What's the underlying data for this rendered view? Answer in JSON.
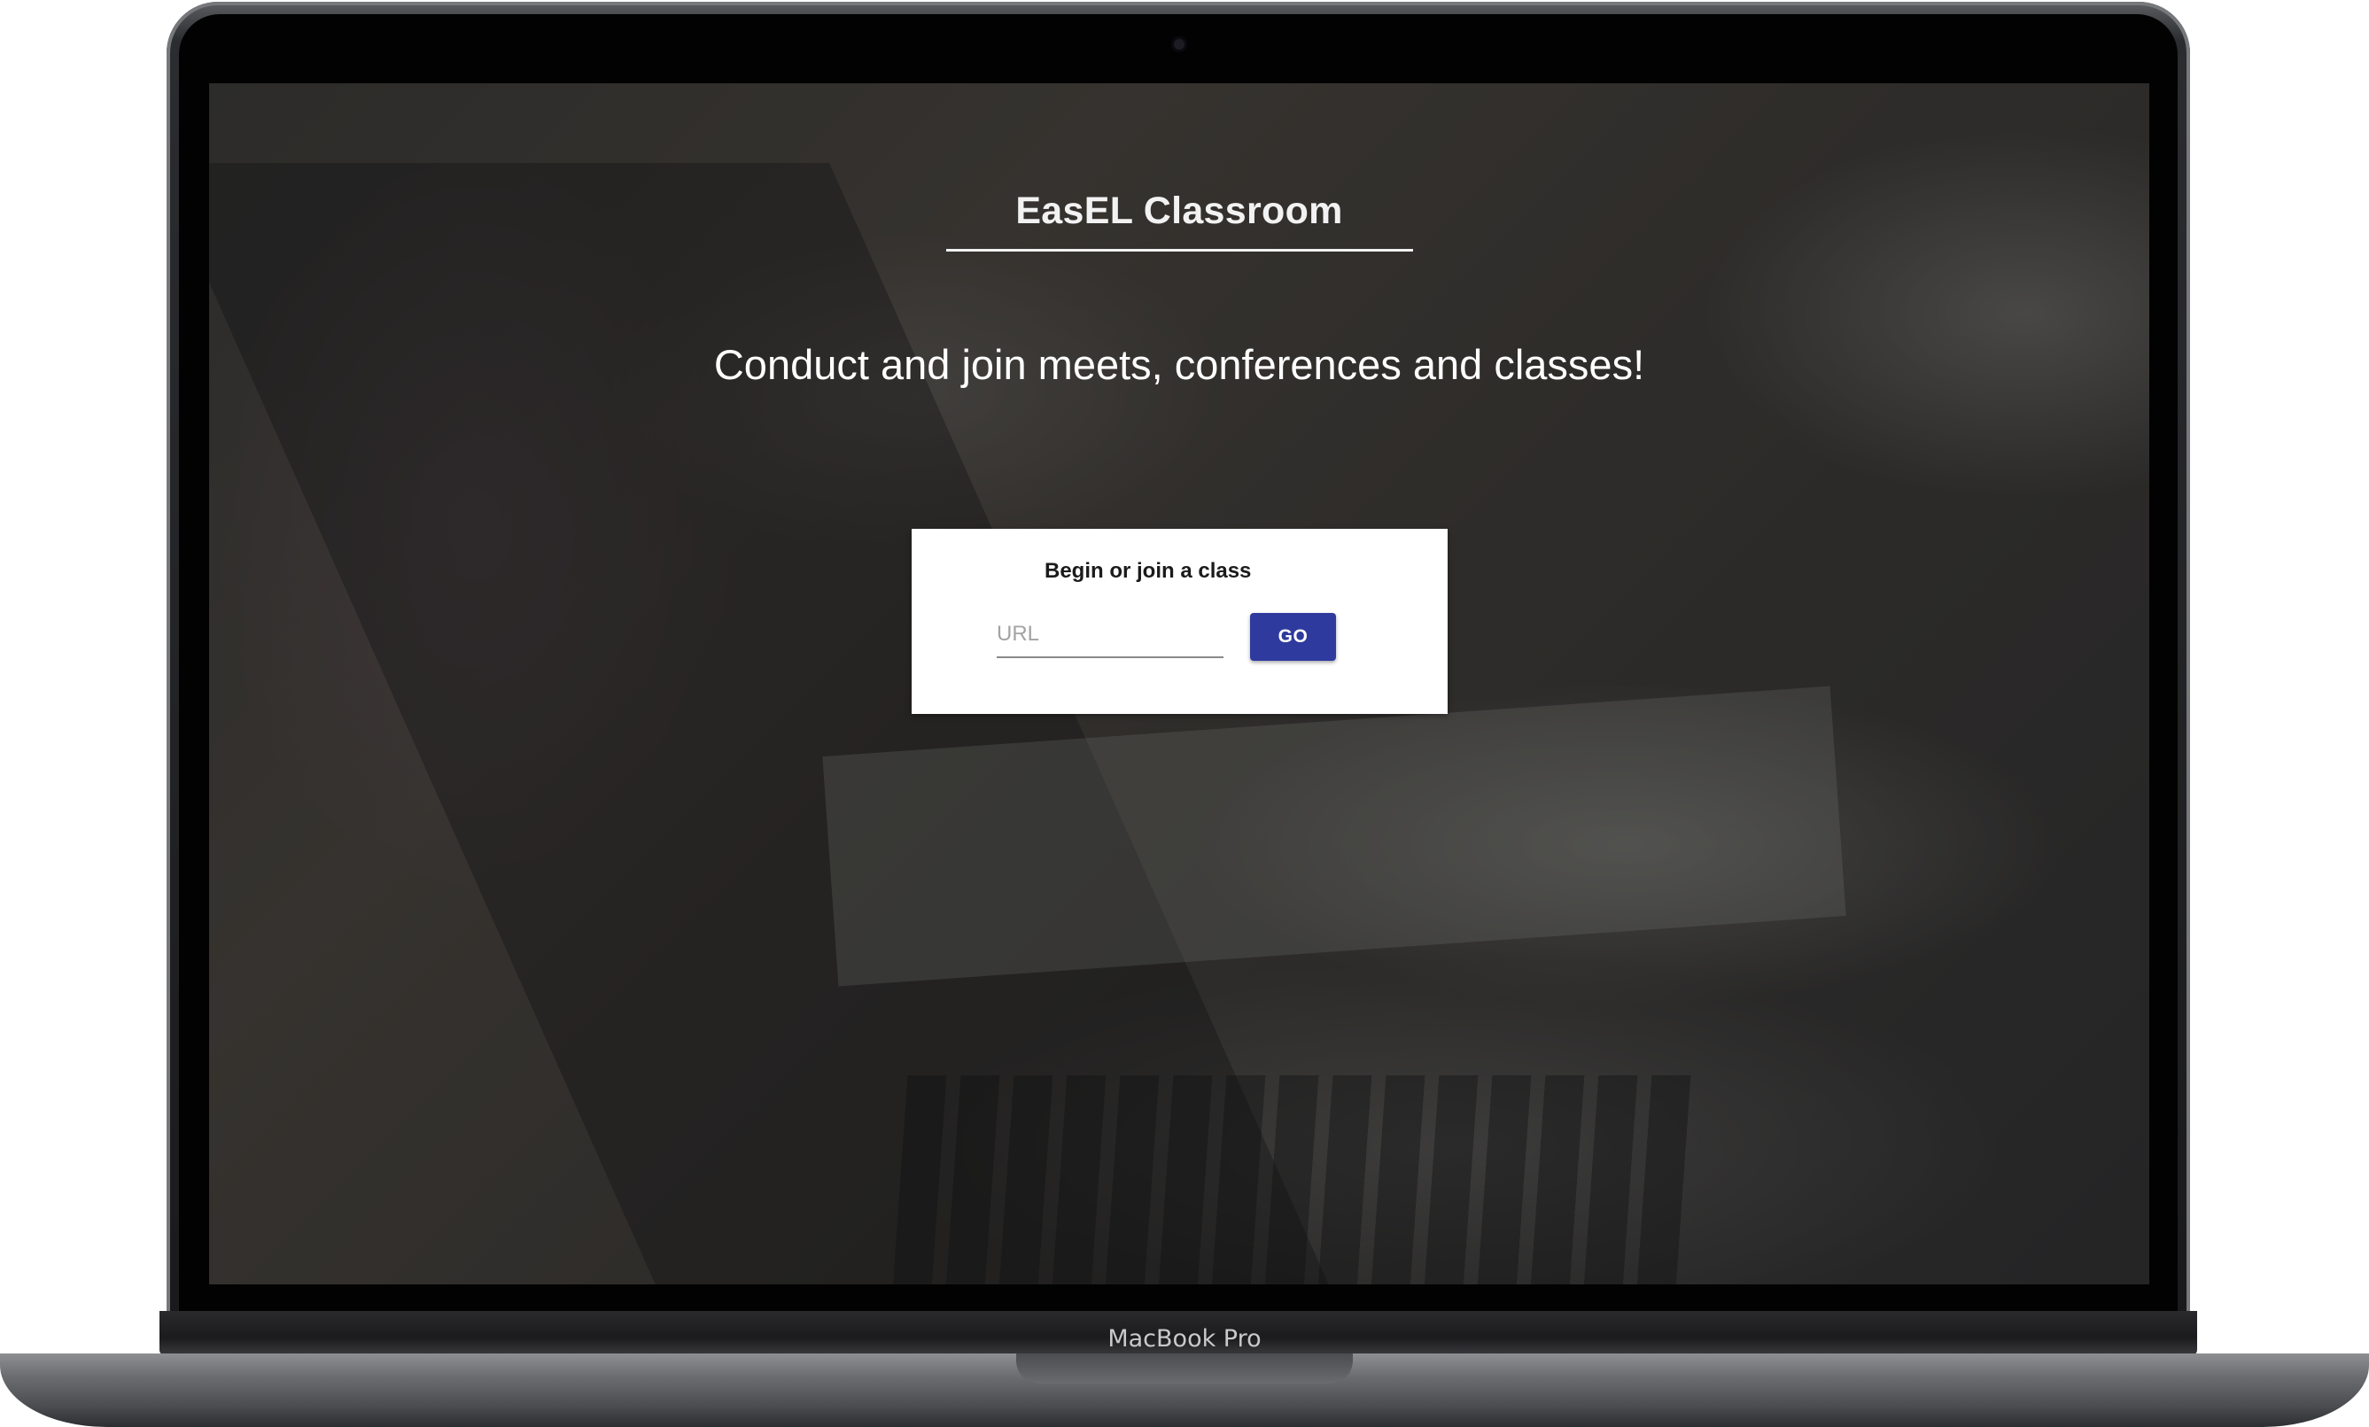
{
  "device": {
    "model_label": "MacBook Pro"
  },
  "app": {
    "title": "EasEL Classroom",
    "tagline": "Conduct and join meets, conferences and classes!"
  },
  "join_card": {
    "title": "Begin or join a class",
    "url_placeholder": "URL",
    "url_value": "",
    "go_label": "GO"
  },
  "colors": {
    "button_primary": "#2e3a9e",
    "card_background": "#ffffff",
    "heading_text": "#f2f2f2"
  }
}
